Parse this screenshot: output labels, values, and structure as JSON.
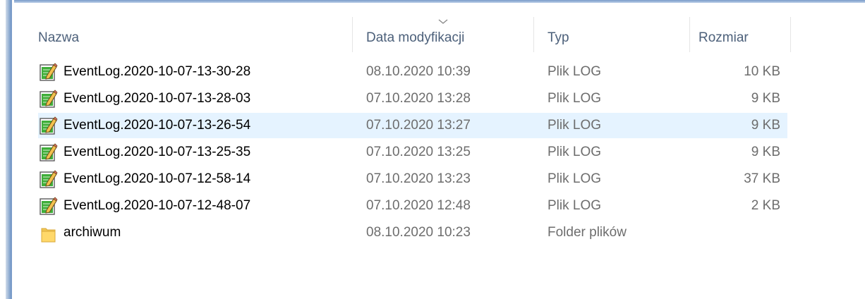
{
  "columns": {
    "name": "Nazwa",
    "date": "Data modyfikacji",
    "type": "Typ",
    "size": "Rozmiar"
  },
  "sort": {
    "column": "date",
    "direction": "descending"
  },
  "selected_row": 2,
  "files": [
    {
      "name": "EventLog.2020-10-07-13-30-28",
      "date": "08.10.2020 10:39",
      "type": "Plik LOG",
      "size": "10 KB",
      "icon": "log-file-icon"
    },
    {
      "name": "EventLog.2020-10-07-13-28-03",
      "date": "07.10.2020 13:28",
      "type": "Plik LOG",
      "size": "9 KB",
      "icon": "log-file-icon"
    },
    {
      "name": "EventLog.2020-10-07-13-26-54",
      "date": "07.10.2020 13:27",
      "type": "Plik LOG",
      "size": "9 KB",
      "icon": "log-file-icon"
    },
    {
      "name": "EventLog.2020-10-07-13-25-35",
      "date": "07.10.2020 13:25",
      "type": "Plik LOG",
      "size": "9 KB",
      "icon": "log-file-icon"
    },
    {
      "name": "EventLog.2020-10-07-12-58-14",
      "date": "07.10.2020 13:23",
      "type": "Plik LOG",
      "size": "37 KB",
      "icon": "log-file-icon"
    },
    {
      "name": "EventLog.2020-10-07-12-48-07",
      "date": "07.10.2020 12:48",
      "type": "Plik LOG",
      "size": "2 KB",
      "icon": "log-file-icon"
    },
    {
      "name": "archiwum",
      "date": "08.10.2020 10:23",
      "type": "Folder plików",
      "size": "",
      "icon": "folder-icon"
    }
  ],
  "colors": {
    "header_text": "#4c607a",
    "selection": "#e5f3ff",
    "secondary_text": "#6d6d6d",
    "window_border": "#7a9cc9"
  }
}
